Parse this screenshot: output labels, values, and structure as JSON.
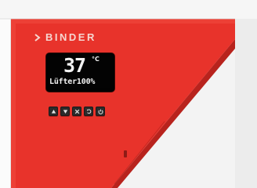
{
  "brand": {
    "name": "BINDER",
    "icon": "binder-logo-icon"
  },
  "display": {
    "temperature": "37",
    "unit": "°C",
    "status": "Lüfter100%"
  },
  "buttons": [
    {
      "name": "up-button",
      "icon": "arrow-up-icon"
    },
    {
      "name": "down-button",
      "icon": "arrow-down-icon"
    },
    {
      "name": "cancel-button",
      "icon": "cross-icon"
    },
    {
      "name": "back-button",
      "icon": "return-icon"
    },
    {
      "name": "power-button",
      "icon": "power-icon"
    }
  ],
  "colors": {
    "panel_red": "#e8332b",
    "panel_dark_red": "#c9261f",
    "housing_gray": "#eeeeee",
    "display_black": "#030303"
  }
}
